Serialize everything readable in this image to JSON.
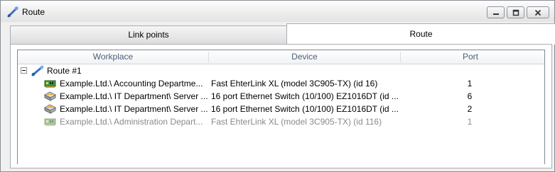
{
  "window": {
    "title": "Route",
    "icon": "route-icon",
    "controls": [
      "minimize",
      "maximize",
      "close"
    ]
  },
  "tabs": [
    {
      "label": "Link points",
      "active": false
    },
    {
      "label": "Route",
      "active": true
    }
  ],
  "grid": {
    "columns": [
      "Workplace",
      "Device",
      "Port"
    ],
    "root": {
      "label": "Route #1",
      "expanded": true,
      "icon": "route-icon"
    },
    "rows": [
      {
        "icon": "network-card-icon",
        "workplace": "Example.Ltd.\\ Accounting Departme...",
        "device": "Fast EhterLink XL (model 3C905-TX) (id 16)",
        "port": "1",
        "dimmed": false
      },
      {
        "icon": "switch-icon",
        "workplace": "Example.Ltd.\\ IT Department\\ Server ...",
        "device": "16 port Ethernet Switch (10/100) EZ1016DT (id ...",
        "port": "6",
        "dimmed": false
      },
      {
        "icon": "switch-icon",
        "workplace": "Example.Ltd.\\ IT Department\\ Server ...",
        "device": "16 port Ethernet Switch (10/100) EZ1016DT (id ...",
        "port": "2",
        "dimmed": false
      },
      {
        "icon": "network-card-icon",
        "workplace": "Example.Ltd.\\ Administration Depart...",
        "device": "Fast EhterLink XL (model 3C905-TX) (id 116)",
        "port": "1",
        "dimmed": true
      }
    ]
  },
  "colors": {
    "header_text": "#4c607a",
    "dimmed_text": "#8a8a8a",
    "border": "#828790"
  }
}
